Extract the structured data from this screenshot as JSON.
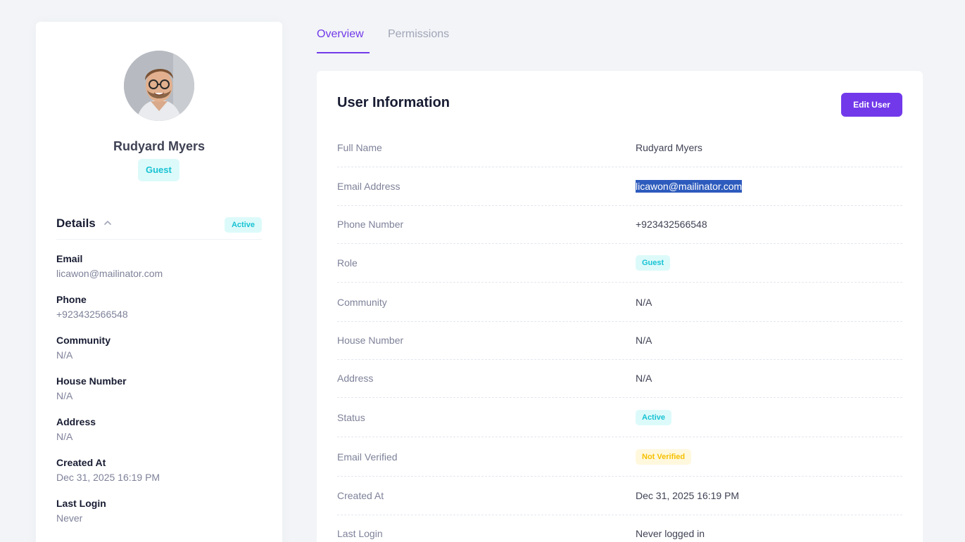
{
  "profile": {
    "name": "Rudyard Myers",
    "role_badge": "Guest",
    "details_title": "Details",
    "status_badge": "Active",
    "details": [
      {
        "label": "Email",
        "value": "licawon@mailinator.com"
      },
      {
        "label": "Phone",
        "value": "+923432566548"
      },
      {
        "label": "Community",
        "value": "N/A"
      },
      {
        "label": "House Number",
        "value": "N/A"
      },
      {
        "label": "Address",
        "value": "N/A"
      },
      {
        "label": "Created At",
        "value": "Dec 31, 2025 16:19 PM"
      },
      {
        "label": "Last Login",
        "value": "Never"
      }
    ]
  },
  "tabs": [
    {
      "label": "Overview",
      "active": true
    },
    {
      "label": "Permissions",
      "active": false
    }
  ],
  "info": {
    "title": "User Information",
    "edit_button": "Edit User",
    "rows": [
      {
        "label": "Full Name",
        "value": "Rudyard Myers"
      },
      {
        "label": "Email Address",
        "value": "licawon@mailinator.com"
      },
      {
        "label": "Phone Number",
        "value": "+923432566548"
      },
      {
        "label": "Role",
        "value": "Guest"
      },
      {
        "label": "Community",
        "value": "N/A"
      },
      {
        "label": "House Number",
        "value": "N/A"
      },
      {
        "label": "Address",
        "value": "N/A"
      },
      {
        "label": "Status",
        "value": "Active"
      },
      {
        "label": "Email Verified",
        "value": "Not Verified"
      },
      {
        "label": "Created At",
        "value": "Dec 31, 2025 16:19 PM"
      },
      {
        "label": "Last Login",
        "value": "Never logged in"
      }
    ]
  },
  "colors": {
    "accent": "#7239ea",
    "info": "#17c3d4",
    "info_bg": "#ddfafa",
    "warning": "#f6c000",
    "warning_bg": "#fff8dd",
    "selection": "#2d5bbd"
  },
  "icons": {
    "details_toggle": "chevron-up-icon"
  }
}
